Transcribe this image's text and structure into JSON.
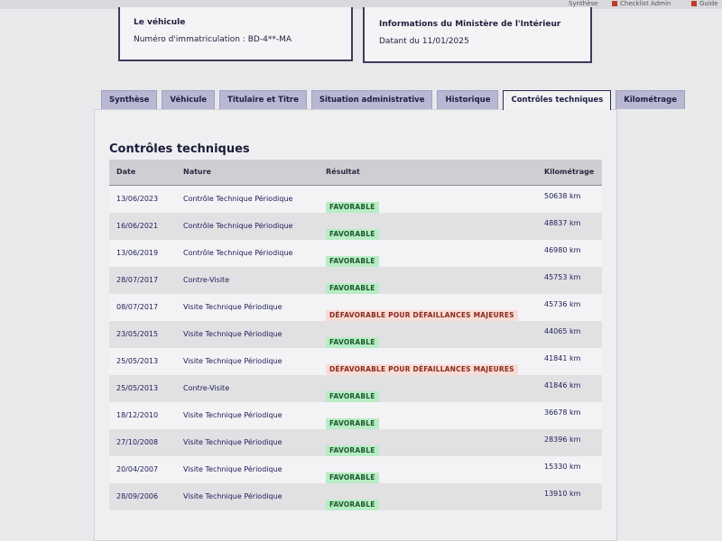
{
  "browser": {
    "bookmarks": [
      "Synthèse",
      "Checklist Admin",
      "Guide"
    ]
  },
  "vehicle_card": {
    "title": "Le véhicule",
    "plate_line": "Numéro d'immatriculation : BD-4**-MA"
  },
  "ministry_card": {
    "title": "Informations du Ministère de l'Intérieur",
    "date_line": "Datant du 11/01/2025"
  },
  "tabs": [
    {
      "label": "Synthèse",
      "active": false
    },
    {
      "label": "Véhicule",
      "active": false
    },
    {
      "label": "Titulaire et Titre",
      "active": false
    },
    {
      "label": "Situation administrative",
      "active": false
    },
    {
      "label": "Historique",
      "active": false
    },
    {
      "label": "Contrôles techniques",
      "active": true
    },
    {
      "label": "Kilométrage",
      "active": false
    }
  ],
  "section": {
    "title": "Contrôles techniques"
  },
  "table": {
    "headers": {
      "date": "Date",
      "nature": "Nature",
      "result": "Résultat",
      "km": "Kilométrage"
    },
    "rows": [
      {
        "date": "13/06/2023",
        "nature": "Contrôle Technique Périodique",
        "result": "FAVORABLE",
        "km": "50638 km"
      },
      {
        "date": "16/06/2021",
        "nature": "Contrôle Technique Périodique",
        "result": "FAVORABLE",
        "km": "48837 km"
      },
      {
        "date": "13/06/2019",
        "nature": "Contrôle Technique Périodique",
        "result": "FAVORABLE",
        "km": "46980 km"
      },
      {
        "date": "28/07/2017",
        "nature": "Contre-Visite",
        "result": "FAVORABLE",
        "km": "45753 km"
      },
      {
        "date": "08/07/2017",
        "nature": "Visite Technique Périodique",
        "result": "DÉFAVORABLE POUR DÉFAILLANCES MAJEURES",
        "km": "45736 km"
      },
      {
        "date": "23/05/2015",
        "nature": "Visite Technique Périodique",
        "result": "FAVORABLE",
        "km": "44065 km"
      },
      {
        "date": "25/05/2013",
        "nature": "Visite Technique Périodique",
        "result": "DÉFAVORABLE POUR DÉFAILLANCES MAJEURES",
        "km": "41841 km"
      },
      {
        "date": "25/05/2013",
        "nature": "Contre-Visite",
        "result": "FAVORABLE",
        "km": "41846 km"
      },
      {
        "date": "18/12/2010",
        "nature": "Visite Technique Périodique",
        "result": "FAVORABLE",
        "km": "36678 km"
      },
      {
        "date": "27/10/2008",
        "nature": "Visite Technique Périodique",
        "result": "FAVORABLE",
        "km": "28396 km"
      },
      {
        "date": "20/04/2007",
        "nature": "Visite Technique Périodique",
        "result": "FAVORABLE",
        "km": "15330 km"
      },
      {
        "date": "28/09/2006",
        "nature": "Visite Technique Périodique",
        "result": "FAVORABLE",
        "km": "13910 km"
      }
    ]
  },
  "colors": {
    "favorable_bg": "#b8ecc4",
    "defavorable_bg": "#f8dcd6",
    "tab_bg": "#b8b8d2",
    "active_tab_border": "#2b2b55"
  }
}
